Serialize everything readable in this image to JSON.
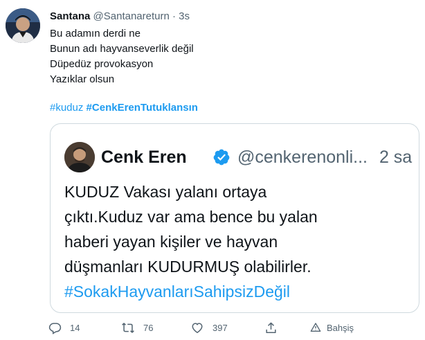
{
  "tweet": {
    "author_name": "Santana",
    "author_handle": "@Santanareturn",
    "separator": "·",
    "time": "3s",
    "lines": [
      "Bu adamın derdi ne",
      "Bunun adı hayvanseverlik değil",
      "Düpedüz provokasyon",
      "Yazıklar olsun"
    ],
    "hashtags": [
      "#kuduz",
      "#CenkErenTutuklansın"
    ]
  },
  "quoted": {
    "author_name": "Cenk Eren",
    "author_handle": "@cenkerenonli...",
    "time": "2 sa",
    "lines": [
      "KUDUZ Vakası yalanı ortaya",
      "çıktı.Kuduz var ama bence bu yalan",
      "haberi yayan kişiler ve hayvan",
      "düşmanları KUDURMUŞ olabilirler."
    ],
    "hashtag": "#SokakHayvanlarıSahipsizDeğil"
  },
  "actions": {
    "replies": "14",
    "retweets": "76",
    "likes": "397",
    "tip_label": "Bahşiş"
  },
  "colors": {
    "link": "#1d9bf0",
    "muted": "#536471",
    "text": "#0f1419",
    "border": "#cfd9de"
  }
}
